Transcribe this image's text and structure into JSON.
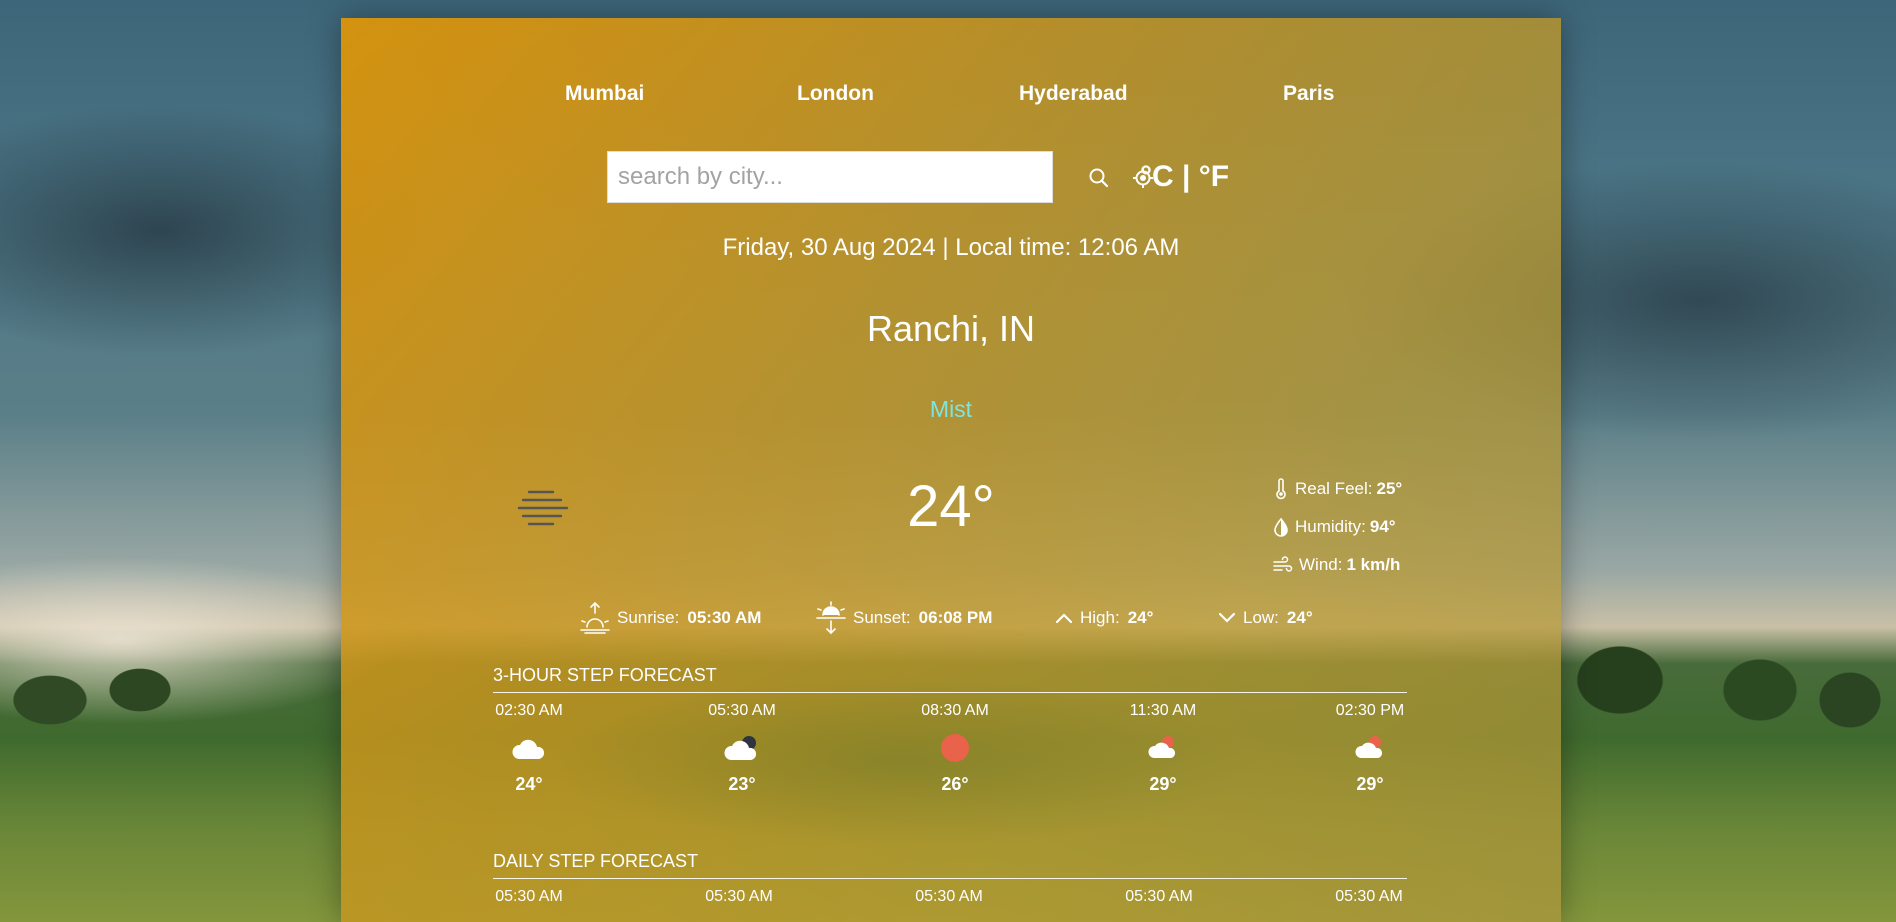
{
  "nav": {
    "cities": [
      "Mumbai",
      "London",
      "Hyderabad",
      "Paris"
    ]
  },
  "search": {
    "placeholder": "search by city...",
    "search_icon": "search-icon",
    "location_icon": "location-crosshair-icon"
  },
  "units": {
    "celsius": "°C",
    "separator": " | ",
    "fahrenheit": "°F"
  },
  "current": {
    "datetime": "Friday, 30 Aug 2024 | Local time: 12:06 AM",
    "location": "Ranchi, IN",
    "condition": "Mist",
    "icon": "mist-icon",
    "temperature": "24°",
    "real_feel_label": "Real Feel:",
    "real_feel": "25°",
    "humidity_label": "Humidity:",
    "humidity": "94°",
    "wind_label": "Wind:",
    "wind": "1 km/h"
  },
  "sun": {
    "sunrise_label": "Sunrise:",
    "sunrise": "05:30 AM",
    "sunset_label": "Sunset:",
    "sunset": "06:08 PM",
    "high_label": "High:",
    "high": "24°",
    "low_label": "Low:",
    "low": "24°"
  },
  "hourly": {
    "title": "3-HOUR STEP FORECAST",
    "items": [
      {
        "time": "02:30 AM",
        "icon": "cloud-icon",
        "temp": "24°"
      },
      {
        "time": "05:30 AM",
        "icon": "cloud-night-icon",
        "temp": "23°"
      },
      {
        "time": "08:30 AM",
        "icon": "sun-icon",
        "temp": "26°"
      },
      {
        "time": "11:30 AM",
        "icon": "cloud-sun-icon",
        "temp": "29°"
      },
      {
        "time": "02:30 PM",
        "icon": "cloud-sun-icon",
        "temp": "29°"
      }
    ]
  },
  "daily": {
    "title": "DAILY STEP FORECAST",
    "items": [
      {
        "time": "05:30 AM"
      },
      {
        "time": "05:30 AM"
      },
      {
        "time": "05:30 AM"
      },
      {
        "time": "05:30 AM"
      },
      {
        "time": "05:30 AM"
      }
    ]
  },
  "colors": {
    "panel_accent": "#dc940a",
    "condition_text": "#7fe3df",
    "sun_icon": "#e8634a"
  }
}
